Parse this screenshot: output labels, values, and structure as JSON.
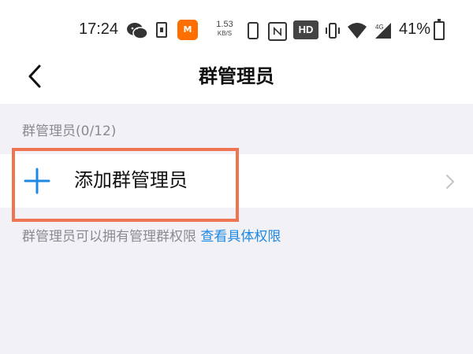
{
  "status_bar": {
    "time": "17:24",
    "app_icon_text": "M",
    "speed_value": "1.53",
    "speed_unit": "KB/S",
    "hd_label": "HD",
    "battery_percent": "41%"
  },
  "nav": {
    "title": "群管理员"
  },
  "section": {
    "header": "群管理员(0/12)"
  },
  "add_row": {
    "label": "添加群管理员"
  },
  "footer": {
    "note": "群管理员可以拥有管理群权限",
    "link": "查看具体权限"
  },
  "colors": {
    "accent": "#1e88e5",
    "highlight": "#ef7452",
    "background": "#f2f2f6"
  }
}
